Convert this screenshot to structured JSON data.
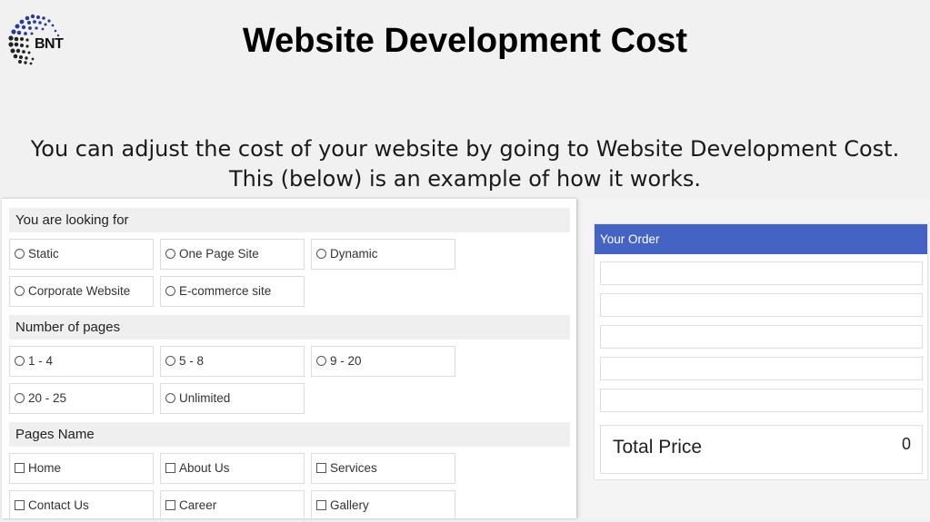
{
  "logo": {
    "text": "BNT",
    "icon": "sphere-dots-icon"
  },
  "title": "Website Development Cost",
  "subtitle": {
    "line1": "You can adjust the cost of your website by going to Website Development Cost.",
    "line2": "This (below) is an example of how it works."
  },
  "form": {
    "looking_for": {
      "label": "You are looking for",
      "options": [
        "Static",
        "One Page Site",
        "Dynamic",
        "Corporate Website",
        "E-commerce site"
      ]
    },
    "pages": {
      "label": "Number of pages",
      "options": [
        "1 - 4",
        "5 - 8",
        "9 - 20",
        "20 - 25",
        "Unlimited"
      ]
    },
    "pages_name": {
      "label": "Pages Name",
      "options": [
        "Home",
        "About Us",
        "Services",
        "Contact Us",
        "Career",
        "Gallery"
      ]
    }
  },
  "order": {
    "header": "Your Order",
    "total_label": "Total Price",
    "total_value": "0"
  },
  "colors": {
    "order_header": "#4563c2",
    "section_bg": "#efefef",
    "page_bg": "#f1f1f1"
  }
}
